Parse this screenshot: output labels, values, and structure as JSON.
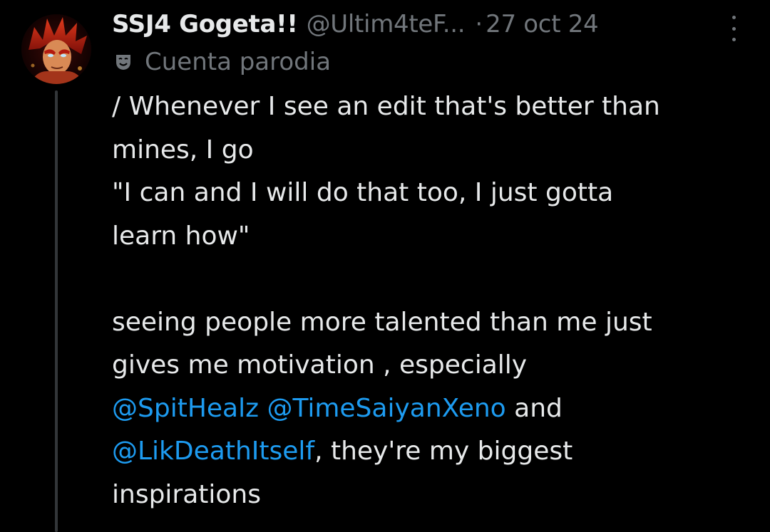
{
  "tweet": {
    "display_name": "SSJ4 Gogeta!!",
    "handle": "@Ultim4teF...",
    "dot": "·",
    "date": "27 oct 24",
    "parody_label": "Cuenta parodia",
    "avatar_icon": "avatar-ssj4-gogeta",
    "more_icon": "more-vertical-icon",
    "parody_icon": "theater-mask-icon",
    "text": {
      "line1": "/ Whenever I see an edit that's better than",
      "line2": "mines, I go",
      "line3": "\"I can and I will do that too, I just gotta",
      "line4": "learn how\"",
      "line5": "seeing people more talented than me just",
      "line6": "gives me motivation , especially",
      "mention1": "@SpitHealz",
      "space1": " ",
      "mention2": "@TimeSaiyanXeno",
      "and_text": " and",
      "mention3": "@LikDeathItself",
      "line8_rest": ", they're my biggest",
      "line9": "inspirations"
    }
  },
  "colors": {
    "background": "#000000",
    "primary_text": "#e7e9ea",
    "secondary_text": "#71767b",
    "mention": "#1d9bf0",
    "thread_line": "#333639"
  }
}
